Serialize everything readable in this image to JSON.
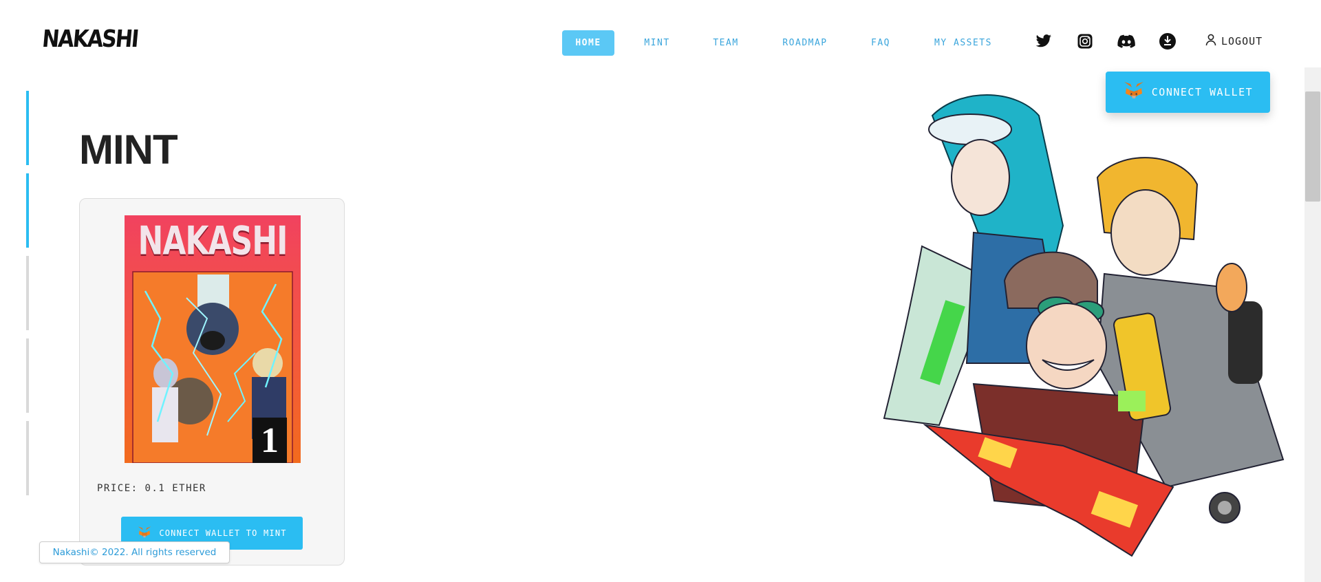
{
  "brand": {
    "logo_text": "NAKASHI"
  },
  "nav": {
    "items": [
      {
        "label": "HOME",
        "active": true
      },
      {
        "label": "MINT",
        "active": false
      },
      {
        "label": "TEAM",
        "active": false
      },
      {
        "label": "ROADMAP",
        "active": false
      },
      {
        "label": "FAQ",
        "active": false
      },
      {
        "label": "MY ASSETS",
        "active": false
      }
    ],
    "social_icons": [
      "twitter-icon",
      "instagram-icon",
      "discord-icon",
      "download-icon"
    ],
    "logout_label": "LOGOUT",
    "connect_wallet_label": "CONNECT WALLET"
  },
  "side_progress": {
    "segments": [
      {
        "active": true
      },
      {
        "active": true
      },
      {
        "active": false
      },
      {
        "active": false
      },
      {
        "active": false
      }
    ]
  },
  "main": {
    "title": "MINT",
    "card": {
      "cover_title": "NAKASHI",
      "cover_issue": "1",
      "price_label": "PRICE: 0.1 ETHER",
      "mint_button_label": "CONNECT WALLET TO MINT"
    }
  },
  "footer": {
    "copyright": "Nakashi© 2022. All rights reserved"
  },
  "colors": {
    "accent": "#2bbdf2",
    "nav_text": "#3aa5dc",
    "active_nav_bg": "#5bc8f5",
    "progress_active": "#2bbdf2",
    "progress_inactive": "#d9d9d9"
  }
}
